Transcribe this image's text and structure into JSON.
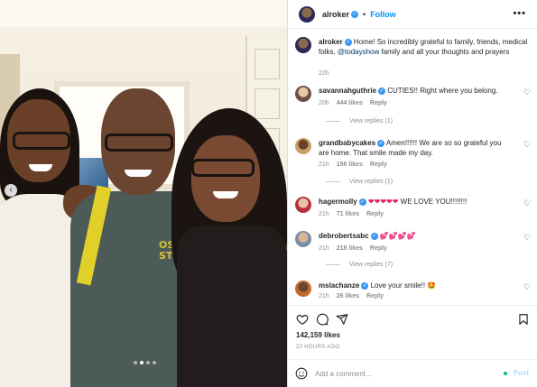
{
  "header": {
    "username": "alroker",
    "separator": "•",
    "follow_label": "Follow",
    "more_label": "•••"
  },
  "caption": {
    "username": "alroker",
    "text_before": "Home! So incredibly grateful to family, friends, medical folks, ",
    "mention": "@todayshow",
    "text_after": " family and all your thoughts and prayers",
    "time": "22h"
  },
  "comments": [
    {
      "username": "savannahguthrie",
      "text": "CUTIES!! Right where you belong.",
      "time": "20h",
      "likes": "444 likes",
      "reply": "Reply",
      "view_replies": "View replies (1)"
    },
    {
      "username": "grandbabycakes",
      "text": "Amen!!!!!! We are so so grateful you are home. That smile made my day.",
      "time": "21h",
      "likes": "156 likes",
      "reply": "Reply",
      "view_replies": "View replies (1)"
    },
    {
      "username": "hagermolly",
      "hearts": "❤❤❤❤❤",
      "text": " WE LOVE YOU!!!!!!!!",
      "time": "21h",
      "likes": "71 likes",
      "reply": "Reply"
    },
    {
      "username": "debrobertsabc",
      "hearts": "💕💕💕💕",
      "time": "21h",
      "likes": "218 likes",
      "reply": "Reply",
      "view_replies": "View replies (7)"
    },
    {
      "username": "mslachanze",
      "text": "Love your smile!! ",
      "emoji": "🤩",
      "time": "21h",
      "likes": "26 likes",
      "reply": "Reply"
    }
  ],
  "photo": {
    "shirt_text": "OSW\nST"
  },
  "likes_count": "142,159 likes",
  "posted_ago": "22 HOURS AGO",
  "add_comment": {
    "placeholder": "Add a comment...",
    "post_label": "Post"
  },
  "colors": {
    "accent": "#0095f6",
    "verified": "#3897f0",
    "muted": "#8e8e8e"
  },
  "icons": [
    "heart-icon",
    "comment-icon",
    "share-icon",
    "bookmark-icon",
    "emoji-icon",
    "verified-badge-icon",
    "more-options-icon"
  ]
}
